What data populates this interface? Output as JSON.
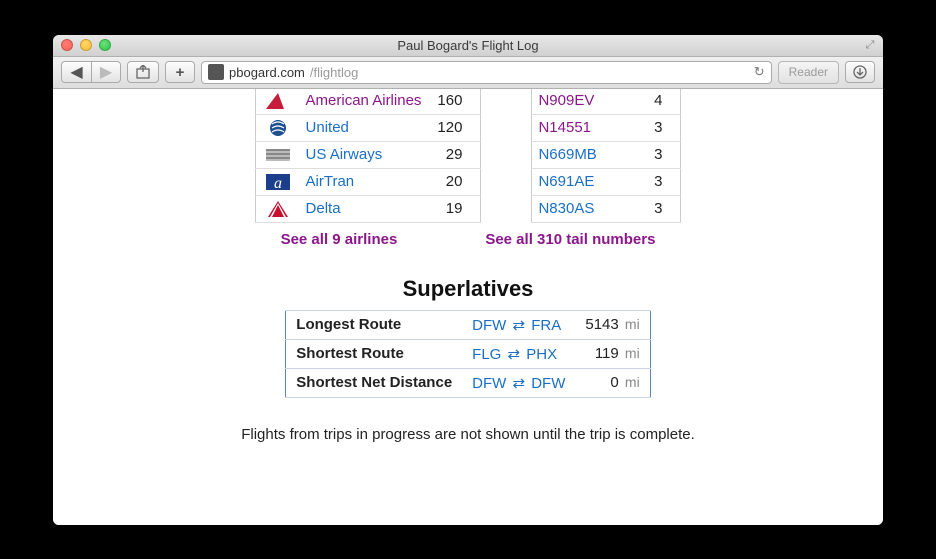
{
  "window": {
    "title": "Paul Bogard's Flight Log"
  },
  "toolbar": {
    "url_host": "pbogard.com",
    "url_path": "/flightlog",
    "reader_label": "Reader"
  },
  "airlines": {
    "rows": [
      {
        "name": "American Airlines",
        "count": "160",
        "visited": true,
        "logo": "aa"
      },
      {
        "name": "United",
        "count": "120",
        "visited": false,
        "logo": "ua"
      },
      {
        "name": "US Airways",
        "count": "29",
        "visited": false,
        "logo": "us"
      },
      {
        "name": "AirTran",
        "count": "20",
        "visited": false,
        "logo": "fl"
      },
      {
        "name": "Delta",
        "count": "19",
        "visited": false,
        "logo": "dl"
      }
    ],
    "see_all": "See all 9 airlines"
  },
  "tails": {
    "rows": [
      {
        "tail": "N909EV",
        "count": "4",
        "visited": true
      },
      {
        "tail": "N14551",
        "count": "3",
        "visited": true
      },
      {
        "tail": "N669MB",
        "count": "3",
        "visited": false
      },
      {
        "tail": "N691AE",
        "count": "3",
        "visited": false
      },
      {
        "tail": "N830AS",
        "count": "3",
        "visited": false
      }
    ],
    "see_all": "See all 310 tail numbers"
  },
  "superlatives": {
    "heading": "Superlatives",
    "rows": [
      {
        "label": "Longest Route",
        "from": "DFW",
        "to": "FRA",
        "dist": "5143",
        "unit": "mi"
      },
      {
        "label": "Shortest Route",
        "from": "FLG",
        "to": "PHX",
        "dist": "119",
        "unit": "mi"
      },
      {
        "label": "Shortest Net Distance",
        "from": "DFW",
        "to": "DFW",
        "dist": "0",
        "unit": "mi"
      }
    ]
  },
  "footnote": "Flights from trips in progress are not shown until the trip is complete."
}
